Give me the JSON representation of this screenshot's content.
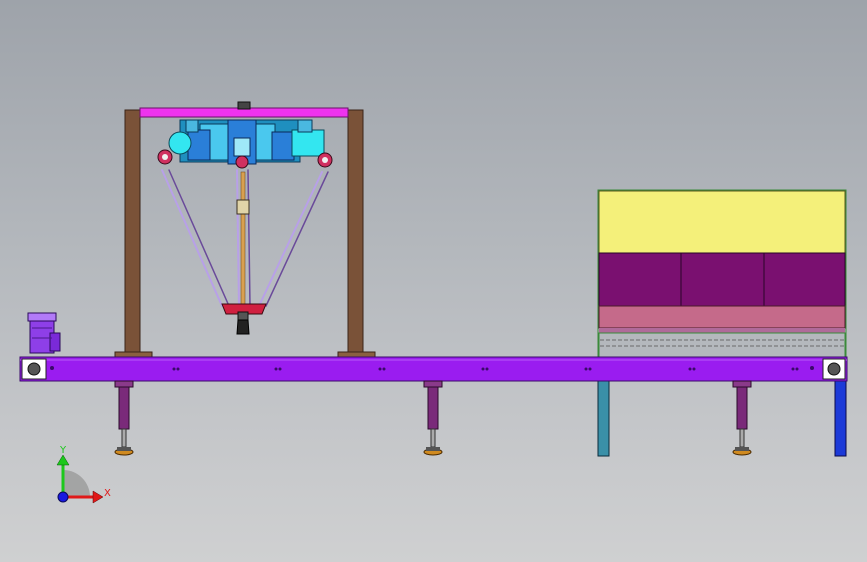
{
  "view": {
    "background_top": "#9ea3aa",
    "background_bottom": "#cfd0d1"
  },
  "colors": {
    "frame_post": "#7a5238",
    "top_beam": "#ee33ee",
    "conveyor_body": "#9a1cf0",
    "conveyor_outline": "#3a0a6a",
    "leg": "#7a2a7a",
    "foot": "#d08a20",
    "motor": "#8e3fe8",
    "servo_motor": "#33e6f0",
    "gearbox": "#2a7fd8",
    "delta_arm": "#b8a0e8",
    "gripper": "#d02040",
    "cabinet_top": "#f4f07a",
    "cabinet_panel": "#7a1070",
    "cabinet_band": "#c56a8a",
    "cabinet_leg_left": "#3a90a8",
    "cabinet_leg_right": "#1c3ad8"
  },
  "triad": {
    "x_label": "X",
    "y_label": "Y",
    "x_color": "#e01818",
    "y_color": "#1cc81c",
    "z_color": "#1818e0"
  }
}
